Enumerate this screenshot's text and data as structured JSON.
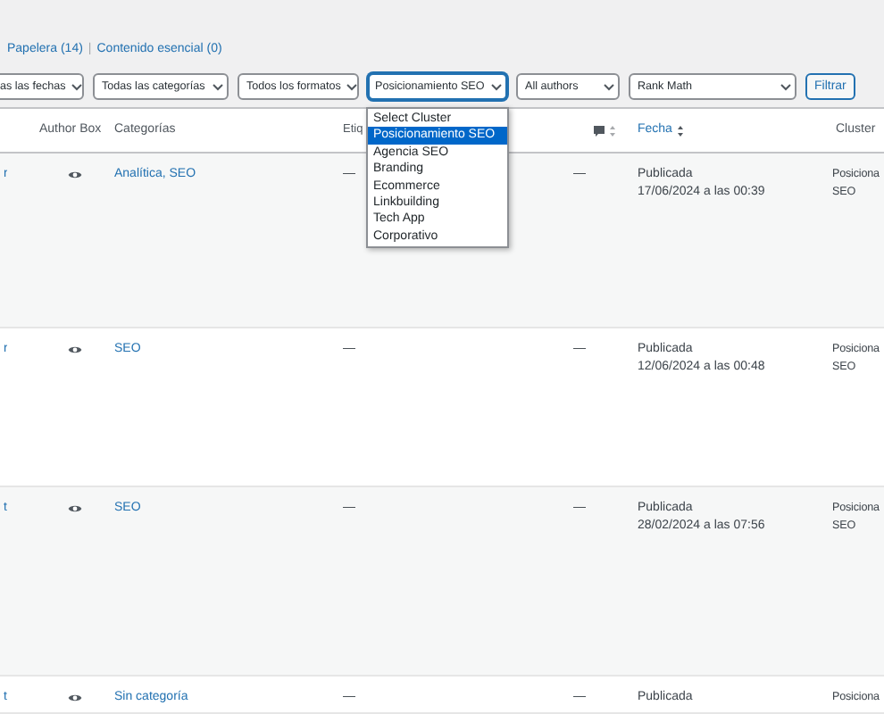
{
  "views": [
    {
      "label": "Papelera (14)"
    },
    {
      "label": "Contenido esencial (0)"
    }
  ],
  "view_separator": "|",
  "filters": [
    {
      "kind": "select",
      "value": "as las fechas"
    },
    {
      "kind": "select",
      "value": "Todas las categorías"
    },
    {
      "kind": "select",
      "value": "Todos los formatos"
    },
    {
      "kind": "select",
      "value": "Posicionamiento SEO",
      "open": true
    },
    {
      "kind": "select",
      "value": "All authors"
    },
    {
      "kind": "select",
      "value": "Rank Math"
    },
    {
      "kind": "button",
      "value": "Filtrar"
    }
  ],
  "cluster_options": [
    {
      "label": "Select Cluster",
      "selected": false
    },
    {
      "label": "Posicionamiento SEO",
      "selected": true
    },
    {
      "label": "Agencia SEO",
      "selected": false
    },
    {
      "label": "Branding",
      "selected": false
    },
    {
      "label": "Ecommerce",
      "selected": false
    },
    {
      "label": "Linkbuilding",
      "selected": false
    },
    {
      "label": "Tech App",
      "selected": false
    },
    {
      "label": "Corporativo",
      "selected": false
    }
  ],
  "table": {
    "headers": {
      "author_box": "Author Box",
      "categories": "Categorías",
      "tags": "Etiq",
      "date": "Fecha",
      "cluster": "Cluster"
    },
    "rows": [
      {
        "author": "r",
        "categories": "Analítica, SEO",
        "tags": "—",
        "comments": "—",
        "status": "Publicada",
        "date": "17/06/2024 a las 00:39",
        "cluster": [
          "Posiciona",
          "SEO"
        ]
      },
      {
        "author": "r",
        "categories": "SEO",
        "tags": "—",
        "comments": "—",
        "status": "Publicada",
        "date": "12/06/2024 a las 00:48",
        "cluster": [
          "Posiciona",
          "SEO"
        ]
      },
      {
        "author": "t",
        "categories": "SEO",
        "tags": "—",
        "comments": "—",
        "status": "Publicada",
        "date": "28/02/2024 a las 07:56",
        "cluster": [
          "Posiciona",
          "SEO"
        ]
      },
      {
        "author": "t",
        "categories": "Sin categoría",
        "tags": "—",
        "comments": "—",
        "status": "Publicada",
        "cluster": [
          "Posiciona"
        ]
      }
    ]
  }
}
